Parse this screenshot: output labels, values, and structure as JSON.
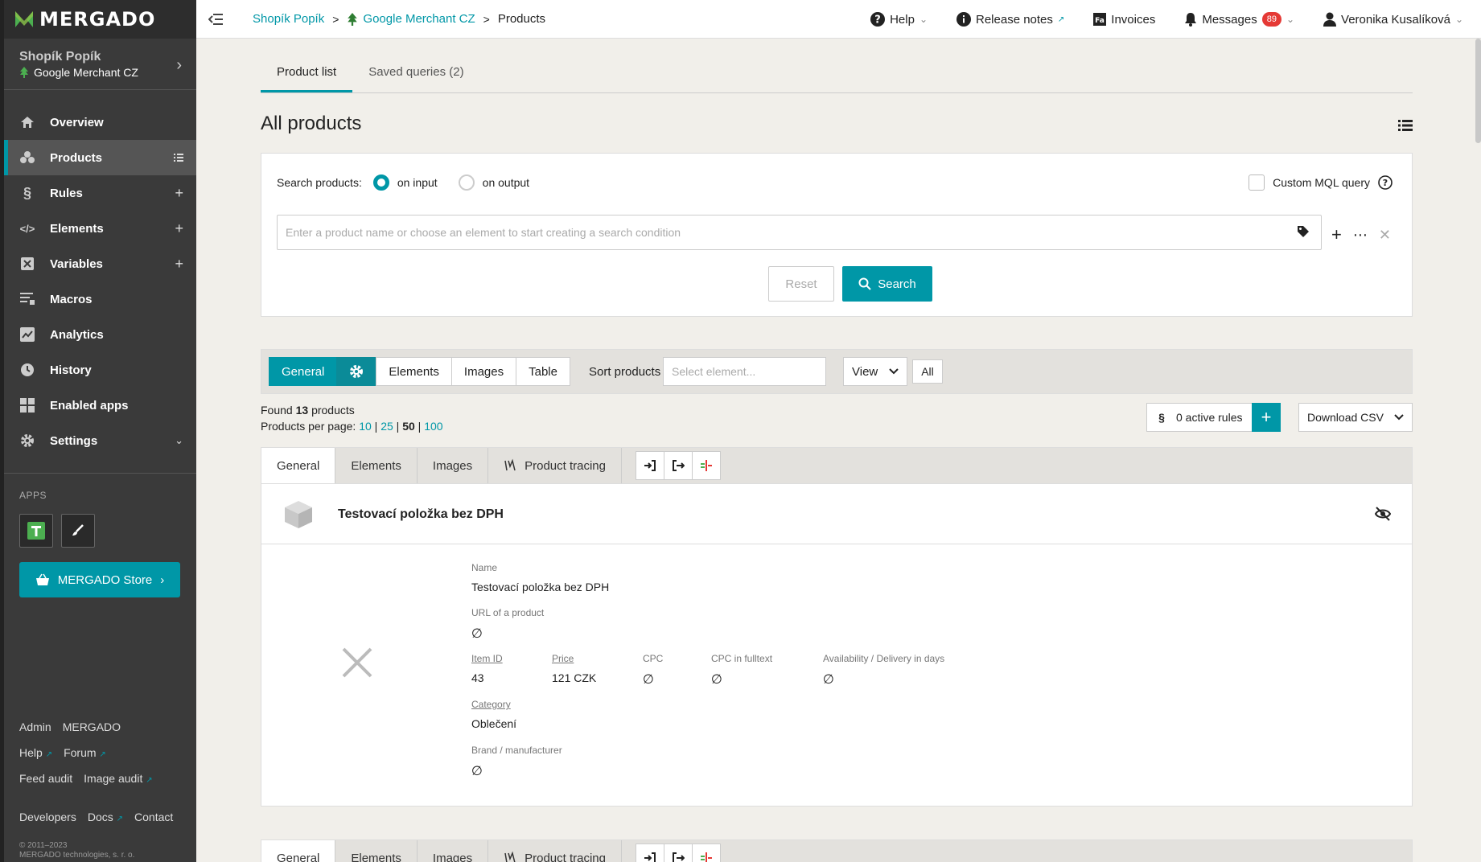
{
  "brand": {
    "logo_text": "MERGADO",
    "accent": "#0097a7"
  },
  "sidebar": {
    "shop_name": "Shopík Popík",
    "shop_channel": "Google Merchant CZ",
    "items": [
      {
        "label": "Overview",
        "icon": "home-icon"
      },
      {
        "label": "Products",
        "icon": "products-icon"
      },
      {
        "label": "Rules",
        "icon": "paragraph-icon"
      },
      {
        "label": "Elements",
        "icon": "code-icon"
      },
      {
        "label": "Variables",
        "icon": "variable-icon"
      },
      {
        "label": "Macros",
        "icon": "macro-icon"
      },
      {
        "label": "Analytics",
        "icon": "chart-icon"
      },
      {
        "label": "History",
        "icon": "clock-icon"
      },
      {
        "label": "Enabled apps",
        "icon": "grid-icon"
      },
      {
        "label": "Settings",
        "icon": "gear-icon"
      }
    ],
    "apps_title": "APPS",
    "store_label": "MERGADO Store",
    "links": {
      "admin": "Admin",
      "mergado": "MERGADO",
      "help": "Help",
      "forum": "Forum",
      "feed_audit": "Feed audit",
      "image_audit": "Image audit",
      "developers": "Developers",
      "docs": "Docs",
      "contact": "Contact"
    },
    "copyright_1": "© 2011–2023",
    "copyright_2": "MERGADO technologies, s. r. o."
  },
  "topbar": {
    "crumb_shop": "Shopík Popík",
    "crumb_channel": "Google Merchant CZ",
    "crumb_current": "Products",
    "help": "Help",
    "release_notes": "Release notes",
    "invoices": "Invoices",
    "messages": "Messages",
    "messages_count": "89",
    "user": "Veronika Kusalíková"
  },
  "main": {
    "tabs": [
      "Product list",
      "Saved queries (2)"
    ],
    "title": "All products",
    "search": {
      "label": "Search products:",
      "opt_input": "on input",
      "opt_output": "on output",
      "mql": "Custom MQL query",
      "placeholder": "Enter a product name or choose an element to start creating a search condition",
      "reset": "Reset",
      "search": "Search"
    },
    "toolbar": {
      "general": "General",
      "elements": "Elements",
      "images": "Images",
      "table": "Table",
      "sort_label": "Sort products",
      "sort_placeholder": "Select element...",
      "view": "View",
      "all": "All"
    },
    "found_prefix": "Found",
    "found_count": "13",
    "found_suffix": "products",
    "per_page_label": "Products per page:",
    "per_page": [
      "10",
      "25",
      "50",
      "100"
    ],
    "active_rules": "0 active rules",
    "download_csv": "Download CSV",
    "card_tabs": [
      "General",
      "Elements",
      "Images",
      "Product tracing"
    ],
    "product": {
      "title": "Testovací položka bez DPH",
      "name_label": "Name",
      "name": "Testovací položka bez DPH",
      "url_label": "URL of a product",
      "item_id_label": "Item ID",
      "item_id": "43",
      "price_label": "Price",
      "price": "121 CZK",
      "cpc_label": "CPC",
      "cpc_full_label": "CPC in fulltext",
      "availability_label": "Availability / Delivery in days",
      "category_label": "Category",
      "category": "Oblečení",
      "brand_label": "Brand / manufacturer",
      "empty_symbol": "∅"
    }
  }
}
